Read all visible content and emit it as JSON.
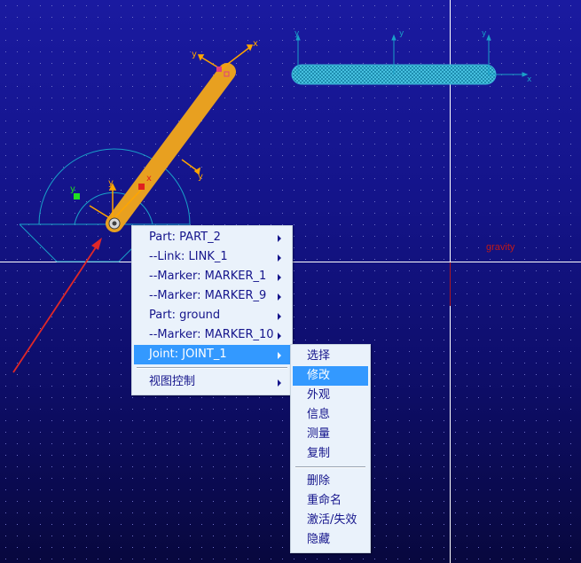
{
  "viewport": {
    "gravity_label": "gravity",
    "axis_labels": {
      "x": "x",
      "y": "y"
    }
  },
  "context_menu": {
    "items": [
      {
        "label": "Part: PART_2"
      },
      {
        "label": "--Link: LINK_1"
      },
      {
        "label": "--Marker: MARKER_1"
      },
      {
        "label": "--Marker: MARKER_9"
      },
      {
        "label": "Part: ground"
      },
      {
        "label": "--Marker: MARKER_10"
      },
      {
        "label": "Joint: JOINT_1",
        "state": "highlighted"
      },
      {
        "label": "视图控制"
      }
    ]
  },
  "submenu": {
    "items": [
      {
        "label": "选择"
      },
      {
        "label": "修改",
        "state": "highlighted"
      },
      {
        "label": "外观"
      },
      {
        "label": "信息"
      },
      {
        "label": "测量"
      },
      {
        "label": "复制"
      },
      {
        "label": "删除"
      },
      {
        "label": "重命名"
      },
      {
        "label": "激活/失效"
      },
      {
        "label": "隐藏"
      }
    ]
  },
  "colors": {
    "link": "#e8a020",
    "marker_axes": "#ffa500",
    "wireframe": "#1aa0c8",
    "crosshair": "#ffffff",
    "annotation_arrow": "#e02828",
    "menu_highlight": "#3399ff"
  }
}
